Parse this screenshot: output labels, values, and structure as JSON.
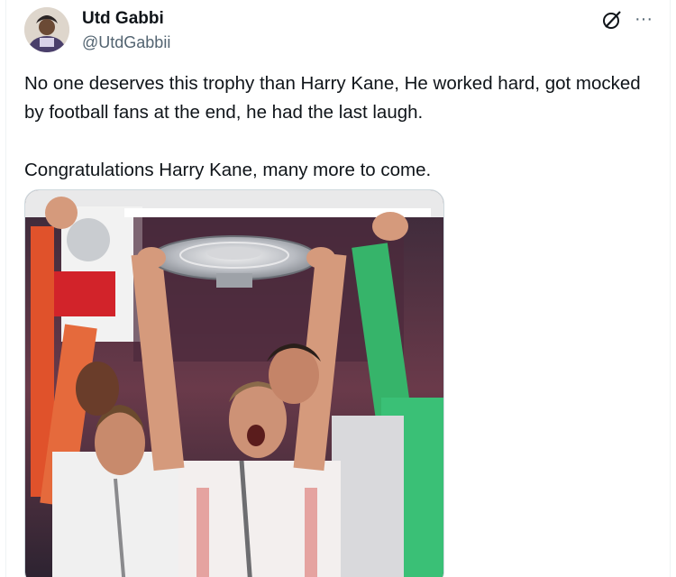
{
  "tweet": {
    "author": {
      "display_name": "Utd Gabbi",
      "handle": "@UtdGabbii"
    },
    "text_lines": [
      "No one deserves this trophy than Harry Kane, He worked hard, got mocked by football fans at the end, he had the last laugh.",
      "Congratulations Harry Kane, many more to come."
    ],
    "icons": {
      "grok": "grok-icon",
      "more": "more-icon"
    },
    "more_glyph": "···"
  },
  "colors": {
    "text_primary": "#0f1419",
    "text_secondary": "#536471",
    "border": "#cfd9de"
  }
}
